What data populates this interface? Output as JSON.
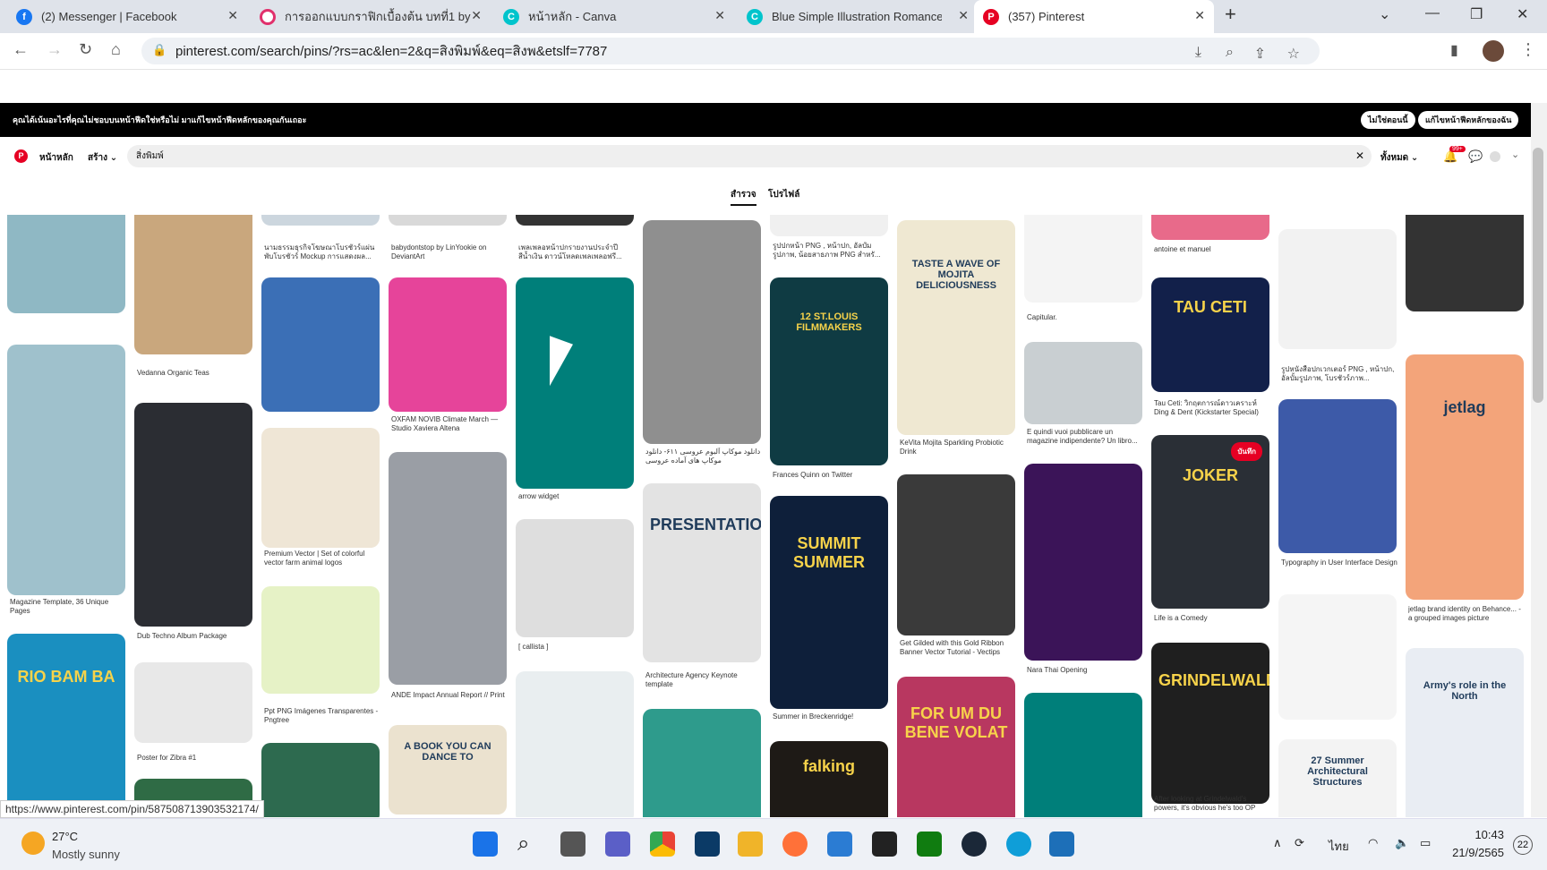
{
  "browser": {
    "tabs": [
      {
        "title": "(2) Messenger | Facebook",
        "icon": "facebook-icon",
        "color": "#1877f2"
      },
      {
        "title": "การออกแบบกราฟิกเบื้องต้น บทที่1 by",
        "icon": "record-icon",
        "color": "#e1306c"
      },
      {
        "title": "หน้าหลัก - Canva",
        "icon": "canva-icon",
        "color": "#00c4cc"
      },
      {
        "title": "Blue Simple Illustration Romance",
        "icon": "canva-icon",
        "color": "#00c4cc"
      },
      {
        "title": "(357) Pinterest",
        "icon": "pinterest-icon",
        "color": "#e60023"
      }
    ],
    "new_tab": "+",
    "url": "pinterest.com/search/pins/?rs=ac&len=2&q=สิงพิมพ์&eq=สิงพ&etslf=7787"
  },
  "banner": {
    "text": "คุณได้เน้นอะไรที่คุณไม่ชอบบนหน้าฟีดใช่หรือไม่ มาแก้ไขหน้าฟีดหลักของคุณกันเถอะ",
    "btn1": "ไม่ใช่ตอนนี้",
    "btn2": "แก้ไขหน้าฟีดหลักของฉัน"
  },
  "pinterest": {
    "home": "หน้าหลัก",
    "create": "สร้าง",
    "search_value": "สิ่งพิมพ์",
    "filter": "ทั้งหมด",
    "notif_badge": "99+",
    "tabs": [
      "สำรวจ",
      "โปรไฟล์"
    ]
  },
  "pins": [
    {
      "cap": "",
      "c": "#8fb8c4"
    },
    {
      "cap": "Magazine Template, 36 Unique Pages",
      "c": "#9fc1cc"
    },
    {
      "cap": "",
      "c": "#1a8fc0",
      "text": "RIO BAM BA"
    },
    {
      "cap": "Vedanna Organic Teas",
      "c": "#c9a77d"
    },
    {
      "cap": "Dub Techno Album Package",
      "c": "#2b2d33"
    },
    {
      "cap": "Poster for Zibra #1",
      "c": "#e8e8e8"
    },
    {
      "cap": "",
      "c": "#2f6b45"
    },
    {
      "cap": "นามธรรมธุรกิจโฆษณาโบรชัวร์แผ่นพับโบรชัวร์ Mockup การแสดงผล...",
      "c": "#ccd6de"
    },
    {
      "cap": "",
      "c": "#3b6fb6"
    },
    {
      "cap": "Premium Vector | Set of colorful vector farm animal logos",
      "c": "#efe6d6"
    },
    {
      "cap": "Ppt PNG Imágenes Transparentes - Pngtree",
      "c": "#e6f2c6"
    },
    {
      "cap": "",
      "c": "#2d6a4f"
    },
    {
      "cap": "babydontstop by LinYookie on DeviantArt",
      "c": "#d9d9d9"
    },
    {
      "cap": "OXFAM NOVIB Climate March — Studio Xaviera Altena",
      "c": "#e6449a"
    },
    {
      "cap": "ANDE Impact Annual Report // Print",
      "c": "#9a9ea5"
    },
    {
      "cap": "",
      "c": "#ebe2cf",
      "text": "A BOOK YOU CAN DANCE TO"
    },
    {
      "cap": "เพลเพลอหน้าปกรายงานประจำปี สีน้ำเงิน ดาวน์โหลดเพลเพลอฟรี...",
      "c": "#333"
    },
    {
      "cap": "arrow widget",
      "c": "#007f7a"
    },
    {
      "cap": "[ callista ]",
      "c": "#dedede"
    },
    {
      "cap": "",
      "c": "#e9eef0"
    },
    {
      "cap": "دانلود موکاپ آلبوم عروسی ۶۱۱- دانلود موکاپ های آماده عروسی",
      "c": "#8f8f8f"
    },
    {
      "cap": "Architecture Agency Keynote template",
      "c": "#e3e3e3",
      "text": "PRESENTATION"
    },
    {
      "cap": "",
      "c": "#2e9b8c"
    },
    {
      "cap": "รูปปกหน้า PNG , หน้าปก, อัลบั้ม รูปภาพ, น้อยสาธภาพ PNG สำหรั...",
      "c": "#f0f0f0"
    },
    {
      "cap": "Frances Quinn on Twitter",
      "c": "#0f3b43",
      "text": "12 ST.LOUIS FILMMAKERS"
    },
    {
      "cap": "Summer in Breckenridge!",
      "c": "#0e1f3a",
      "text": "SUMMIT SUMMER"
    },
    {
      "cap": "",
      "c": "#1e1a16",
      "text": "falking"
    },
    {
      "cap": "KeVita Mojita Sparkling Probiotic Drink",
      "c": "#efe8d2",
      "text": "TASTE A WAVE OF MOJITA DELICIOUSNESS"
    },
    {
      "cap": "Get Gilded with this Gold Ribbon Banner Vector Tutorial - Vectips",
      "c": "#3a3a3a"
    },
    {
      "cap": "",
      "c": "#b83760",
      "text": "FOR UM DU BENE VOLAT"
    },
    {
      "cap": "Capitular.",
      "c": "#f4f4f4"
    },
    {
      "cap": "E quindi vuoi pubblicare un magazine indipendente? Un libro...",
      "c": "#c9cfd2"
    },
    {
      "cap": "Nara Thai Opening",
      "c": "#3b1458"
    },
    {
      "cap": "",
      "c": "#007f7a"
    },
    {
      "cap": "antoine et manuel",
      "c": "#e86a8a"
    },
    {
      "cap": "Tau Ceti: วิกฤตการณ์ดาวเคราะห์ Ding & Dent (Kickstarter Special)",
      "c": "#12204a",
      "text": "TAU CETI"
    },
    {
      "cap": "Life is a Comedy",
      "c": "#2a2f36",
      "text": "JOKER"
    },
    {
      "cap": "After looking at Grindelwald's powers, it's obvious he's too OP",
      "c": "#1f1f1f",
      "text": "GRINDELWALD"
    },
    {
      "cap": "รูปหนังสือปกเวกเตอร์ PNG , หน้าปก, อัลบั้มรูปภาพ, โบรชัวร์ภาพ...",
      "c": "#f2f2f2"
    },
    {
      "cap": "Typography in User Interface Design",
      "c": "#3d5aa8"
    },
    {
      "cap": "",
      "c": "#f5f5f5"
    },
    {
      "cap": "",
      "c": "#f3f3f3",
      "text": "27 Summer Architectural Structures"
    },
    {
      "cap": "",
      "c": "#333"
    },
    {
      "cap": "jetlag brand identity on Behance... - a grouped images picture",
      "c": "#f3a47a",
      "text": "jetlag"
    },
    {
      "cap": "",
      "c": "#e9edf3",
      "text": "Army's role in the North"
    }
  ],
  "pin_badge": "บันทึก",
  "status_url": "https://www.pinterest.com/pin/587508713903532174/",
  "taskbar": {
    "temp": "27°C",
    "weather": "Mostly sunny",
    "lang": "ไทย",
    "time": "10:43",
    "date": "21/9/2565",
    "notif": "22"
  }
}
